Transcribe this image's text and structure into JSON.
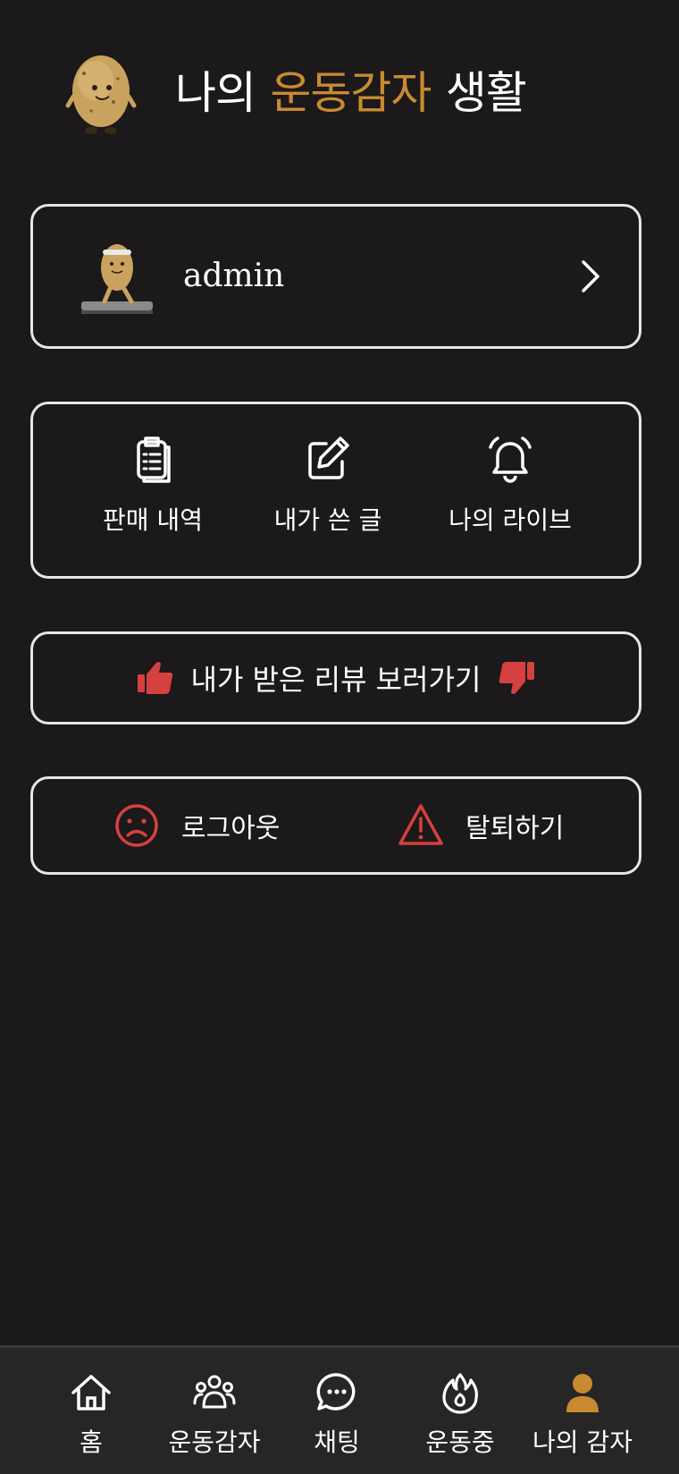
{
  "header": {
    "title_prefix": "나의",
    "title_accent": "운동감자",
    "title_suffix": "생활",
    "mascot_icon": "potato-mascot-icon"
  },
  "colors": {
    "background": "#1b1919",
    "accent": "#c98a32",
    "danger": "#d64040",
    "card_border": "#e6e6e6",
    "nav_background": "#262626"
  },
  "profile": {
    "username": "admin",
    "avatar_icon": "potato-treadmill-avatar",
    "chevron_icon": "chevron-right-icon"
  },
  "menu": {
    "items": [
      {
        "label": "판매 내역",
        "icon": "clipboard-list-icon"
      },
      {
        "label": "내가 쓴 글",
        "icon": "edit-icon"
      },
      {
        "label": "나의 라이브",
        "icon": "bell-icon"
      }
    ]
  },
  "review": {
    "label": "내가 받은 리뷰 보러가기",
    "left_icon": "thumbs-up-icon",
    "right_icon": "thumbs-down-icon"
  },
  "account": {
    "logout_label": "로그아웃",
    "logout_icon": "sad-face-icon",
    "withdraw_label": "탈퇴하기",
    "withdraw_icon": "warning-icon"
  },
  "nav": {
    "items": [
      {
        "label": "홈",
        "icon": "home-icon",
        "active": false
      },
      {
        "label": "운동감자",
        "icon": "group-icon",
        "active": false
      },
      {
        "label": "채팅",
        "icon": "chat-icon",
        "active": false
      },
      {
        "label": "운동중",
        "icon": "fire-icon",
        "active": false
      },
      {
        "label": "나의 감자",
        "icon": "user-icon",
        "active": true
      }
    ]
  }
}
